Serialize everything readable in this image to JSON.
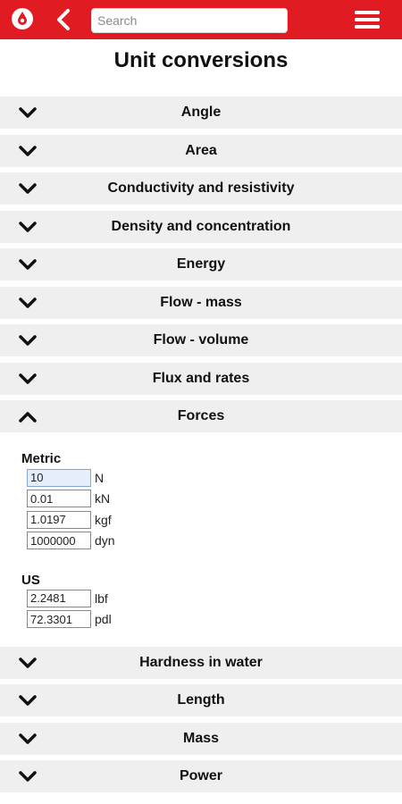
{
  "header": {
    "search_placeholder": "Search",
    "brand_color": "#e11b22",
    "icons": [
      "app-logo-icon",
      "back-arrow-icon",
      "hamburger-menu-icon"
    ]
  },
  "page": {
    "title": "Unit conversions"
  },
  "categories_before": [
    "Angle",
    "Area",
    "Conductivity and resistivity",
    "Density and concentration",
    "Energy",
    "Flow - mass",
    "Flow - volume",
    "Flux and rates"
  ],
  "expanded": {
    "label": "Forces",
    "metric_title": "Metric",
    "metric": [
      {
        "value": "10",
        "unit": "N"
      },
      {
        "value": "0.01",
        "unit": "kN"
      },
      {
        "value": "1.0197",
        "unit": "kgf"
      },
      {
        "value": "1000000",
        "unit": "dyn"
      }
    ],
    "us_title": "US",
    "us": [
      {
        "value": "2.2481",
        "unit": "lbf"
      },
      {
        "value": "72.3301",
        "unit": "pdl"
      }
    ]
  },
  "categories_after": [
    "Hardness in water",
    "Length",
    "Mass",
    "Power"
  ]
}
